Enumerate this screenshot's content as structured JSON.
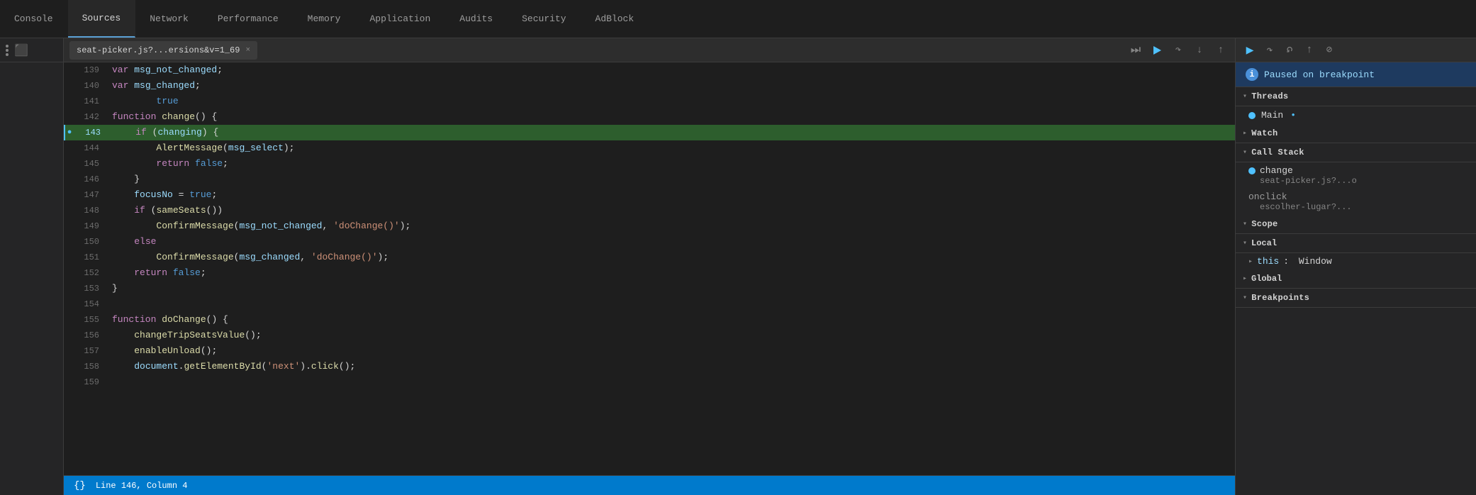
{
  "tabs": [
    {
      "id": "console",
      "label": "Console",
      "active": false
    },
    {
      "id": "sources",
      "label": "Sources",
      "active": true
    },
    {
      "id": "network",
      "label": "Network",
      "active": false
    },
    {
      "id": "performance",
      "label": "Performance",
      "active": false
    },
    {
      "id": "memory",
      "label": "Memory",
      "active": false
    },
    {
      "id": "application",
      "label": "Application",
      "active": false
    },
    {
      "id": "audits",
      "label": "Audits",
      "active": false
    },
    {
      "id": "security",
      "label": "Security",
      "active": false
    },
    {
      "id": "adblock",
      "label": "AdBlock",
      "active": false
    }
  ],
  "file_tab": {
    "name": "seat-picker.js?...ersions&v=1_69",
    "close_label": "×"
  },
  "paused_banner": {
    "text": "Paused on breakpoint"
  },
  "threads": {
    "label": "Threads",
    "items": [
      {
        "name": "Main",
        "active": true
      }
    ]
  },
  "watch": {
    "label": "Watch"
  },
  "call_stack": {
    "label": "Call Stack",
    "items": [
      {
        "fn": "change",
        "file": "seat-picker.js?...o"
      },
      {
        "fn": "onclick",
        "file": "escolher-lugar?..."
      }
    ]
  },
  "scope": {
    "label": "Scope",
    "local": {
      "label": "Local",
      "items": [
        {
          "key": "this",
          "value": "Window"
        }
      ]
    },
    "global": {
      "label": "Global"
    }
  },
  "breakpoints": {
    "label": "Breakpoints"
  },
  "status_bar": {
    "symbol": "{}",
    "text": "Line 146, Column 4"
  },
  "code_lines": [
    {
      "num": 139,
      "content": "var msg_not_changed;",
      "highlight": false,
      "current": false
    },
    {
      "num": 140,
      "content": "var msg_changed;",
      "highlight": false,
      "current": false
    },
    {
      "num": 141,
      "content": "        true",
      "highlight": false,
      "current": false
    },
    {
      "num": 142,
      "content": "function change() {",
      "highlight": false,
      "current": false
    },
    {
      "num": 143,
      "content": "    if (changing) {",
      "highlight": true,
      "current": true
    },
    {
      "num": 144,
      "content": "        AlertMessage(msg_select);",
      "highlight": false,
      "current": false
    },
    {
      "num": 145,
      "content": "        return false;",
      "highlight": false,
      "current": false
    },
    {
      "num": 146,
      "content": "    }",
      "highlight": false,
      "current": false
    },
    {
      "num": 147,
      "content": "    focusNo = true;",
      "highlight": false,
      "current": false
    },
    {
      "num": 148,
      "content": "    if (sameSeats())",
      "highlight": false,
      "current": false
    },
    {
      "num": 149,
      "content": "        ConfirmMessage(msg_not_changed, 'doChange()');",
      "highlight": false,
      "current": false
    },
    {
      "num": 150,
      "content": "    else",
      "highlight": false,
      "current": false
    },
    {
      "num": 151,
      "content": "        ConfirmMessage(msg_changed, 'doChange()');",
      "highlight": false,
      "current": false
    },
    {
      "num": 152,
      "content": "    return false;",
      "highlight": false,
      "current": false
    },
    {
      "num": 153,
      "content": "}",
      "highlight": false,
      "current": false
    },
    {
      "num": 154,
      "content": "",
      "highlight": false,
      "current": false
    },
    {
      "num": 155,
      "content": "function doChange() {",
      "highlight": false,
      "current": false
    },
    {
      "num": 156,
      "content": "    changeTripSeatsValue();",
      "highlight": false,
      "current": false
    },
    {
      "num": 157,
      "content": "    enableUnload();",
      "highlight": false,
      "current": false
    },
    {
      "num": 158,
      "content": "    document.getElementById('next').click();",
      "highlight": false,
      "current": false
    },
    {
      "num": 159,
      "content": "",
      "highlight": false,
      "current": false
    }
  ]
}
